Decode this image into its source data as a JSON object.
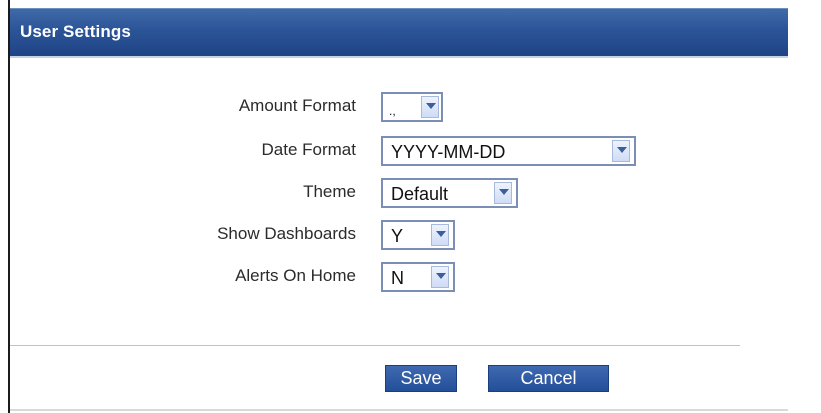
{
  "header": {
    "title": "User Settings"
  },
  "settings": {
    "amount_format": {
      "label": "Amount Format",
      "value": ".,"
    },
    "date_format": {
      "label": "Date Format",
      "value": "YYYY-MM-DD"
    },
    "theme": {
      "label": "Theme",
      "value": "Default"
    },
    "show_dashboards": {
      "label": "Show Dashboards",
      "value": "Y"
    },
    "alerts_on_home": {
      "label": "Alerts On Home",
      "value": "N"
    }
  },
  "actions": {
    "save_label": "Save",
    "cancel_label": "Cancel"
  },
  "colors": {
    "header_blue": "#2b5497",
    "button_blue": "#2f5ca5"
  }
}
